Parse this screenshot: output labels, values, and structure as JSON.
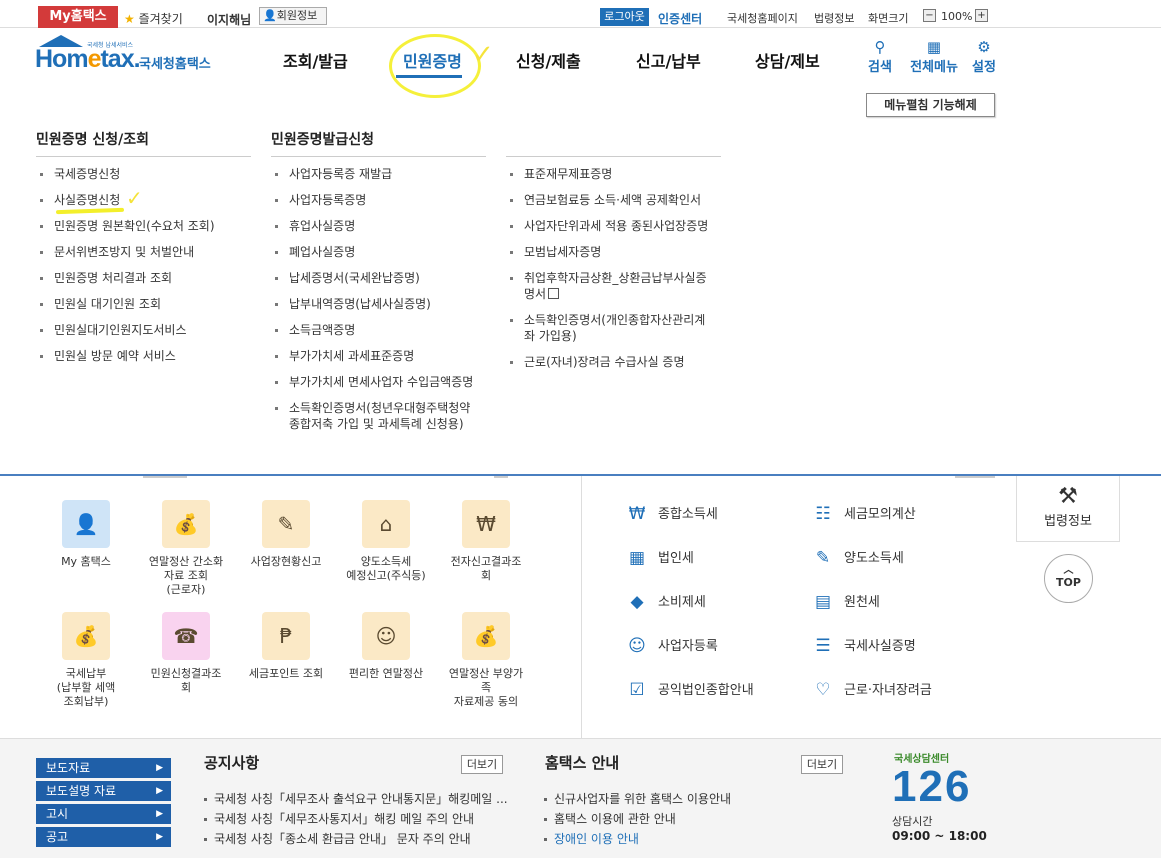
{
  "util": {
    "my_home": "My홈택스",
    "favorites": "즐겨찾기",
    "user_name": "이지해님",
    "member_info": "회원정보",
    "logout": "로그아웃",
    "cert_center": "인증센터",
    "links": [
      "국세청홈페이지",
      "법령정보",
      "화면크기"
    ],
    "zoom": "100%"
  },
  "logo": {
    "brand": "Hometax",
    "brand_e": "e",
    "org": "국세청홈택스",
    "tagline": "국세청 납세서비스"
  },
  "gnb": [
    "조회/발급",
    "민원증명",
    "신청/제출",
    "신고/납부",
    "상담/제보"
  ],
  "header_icons": [
    {
      "label": "검색",
      "icon": "search-icon"
    },
    {
      "label": "전체메뉴",
      "icon": "grid-icon"
    },
    {
      "label": "설정",
      "icon": "gear-icon"
    }
  ],
  "menu_fix_button": "메뉴펼침 기능해제",
  "mega": {
    "col1_title": "민원증명 신청/조회",
    "col1": [
      "국세증명신청",
      "사실증명신청",
      "민원증명 원본확인(수요처 조회)",
      "문서위변조방지 및 처벌안내",
      "민원증명 처리결과 조회",
      "민원실 대기인원 조회",
      "민원실대기인원지도서비스",
      "민원실 방문 예약 서비스"
    ],
    "col2_title": "민원증명발급신청",
    "col2": [
      "사업자등록증 재발급",
      "사업자등록증명",
      "휴업사실증명",
      "폐업사실증명",
      "납세증명서(국세완납증명)",
      "납부내역증명(납세사실증명)",
      "소득금액증명",
      "부가가치세 과세표준증명",
      "부가가치세 면세사업자 수입금액증명",
      "소득확인증명서(청년우대형주택청약",
      "종합저축 가입 및 과세특례 신청용)"
    ],
    "col3": [
      "표준재무제표증명",
      "연금보험료등 소득·세액 공제확인서",
      "사업자단위과세 적용 종된사업장증명",
      "모범납세자증명",
      "취업후학자금상환_상환금납부사실증",
      "명서",
      "소득확인증명서(개인종합자산관리계",
      "좌 가입용)",
      "근로(자녀)장려금 수급사실 증명"
    ]
  },
  "quick": [
    {
      "label": "My 홈택스",
      "icon": "person-icon",
      "color": "#cfe4f7"
    },
    {
      "label": "연말정산 간소화\n자료 조회\n(근로자)",
      "icon": "money-bag-icon",
      "color": "#fbe9c6"
    },
    {
      "label": "사업장현황신고",
      "icon": "document-pen-icon",
      "color": "#fbe9c6"
    },
    {
      "label": "양도소득세\n예정신고(주식등)",
      "icon": "house-icon",
      "color": "#fbe9c6"
    },
    {
      "label": "전자신고결과조회",
      "icon": "search-won-icon",
      "color": "#fbe9c6"
    },
    {
      "label": "국세납부\n(납부할 세액\n조회납부)",
      "icon": "money-bag-icon",
      "color": "#fbe9c6"
    },
    {
      "label": "민원신청결과조회",
      "icon": "headset-icon",
      "color": "#f9d3ef"
    },
    {
      "label": "세금포인트 조회",
      "icon": "tax-bag-icon",
      "color": "#fbe9c6"
    },
    {
      "label": "편리한 연말정산",
      "icon": "face-won-icon",
      "color": "#fbe9c6"
    },
    {
      "label": "연말정산 부양가족\n자료제공 동의",
      "icon": "money-bag-icon",
      "color": "#fbe9c6"
    }
  ],
  "taxes": [
    {
      "label": "종합소득세",
      "icon": "won-hand-icon"
    },
    {
      "label": "세금모의계산",
      "icon": "calculator-icon"
    },
    {
      "label": "법인세",
      "icon": "building-icon"
    },
    {
      "label": "양도소득세",
      "icon": "document-house-icon"
    },
    {
      "label": "소비제세",
      "icon": "diamond-icon"
    },
    {
      "label": "원천세",
      "icon": "salary-icon"
    },
    {
      "label": "사업자등록",
      "icon": "person-icon"
    },
    {
      "label": "국세사실증명",
      "icon": "document-icon"
    },
    {
      "label": "공익법인종합안내",
      "icon": "clipboard-check-icon"
    },
    {
      "label": "근로·자녀장려금",
      "icon": "heart-hands-icon"
    }
  ],
  "law": {
    "label": "법령정보",
    "icon": "gavel-icon"
  },
  "top_button": "TOP",
  "footer": {
    "buttons": [
      "보도자료",
      "보도설명 자료",
      "고시",
      "공고"
    ],
    "notice_title": "공지사항",
    "notice_more": "더보기",
    "notices": [
      "국세청 사칭「세무조사 출석요구 안내통지문」해킹메일 ...",
      "국세청 사칭「세무조사통지서」해킹 메일 주의 안내",
      "국세청 사칭「종소세 환급금 안내」 문자 주의 안내"
    ],
    "guide_title": "홈택스 안내",
    "guide_more": "더보기",
    "guides": [
      "신규사업자를 위한 홈택스 이용안내",
      "홈택스 이용에 관한 안내",
      "장애인 이용 안내"
    ],
    "center_title": "국세상담센터",
    "center_num": "126",
    "center_hours_label": "상담시간",
    "center_hours": "09:00 ~ 18:00"
  }
}
